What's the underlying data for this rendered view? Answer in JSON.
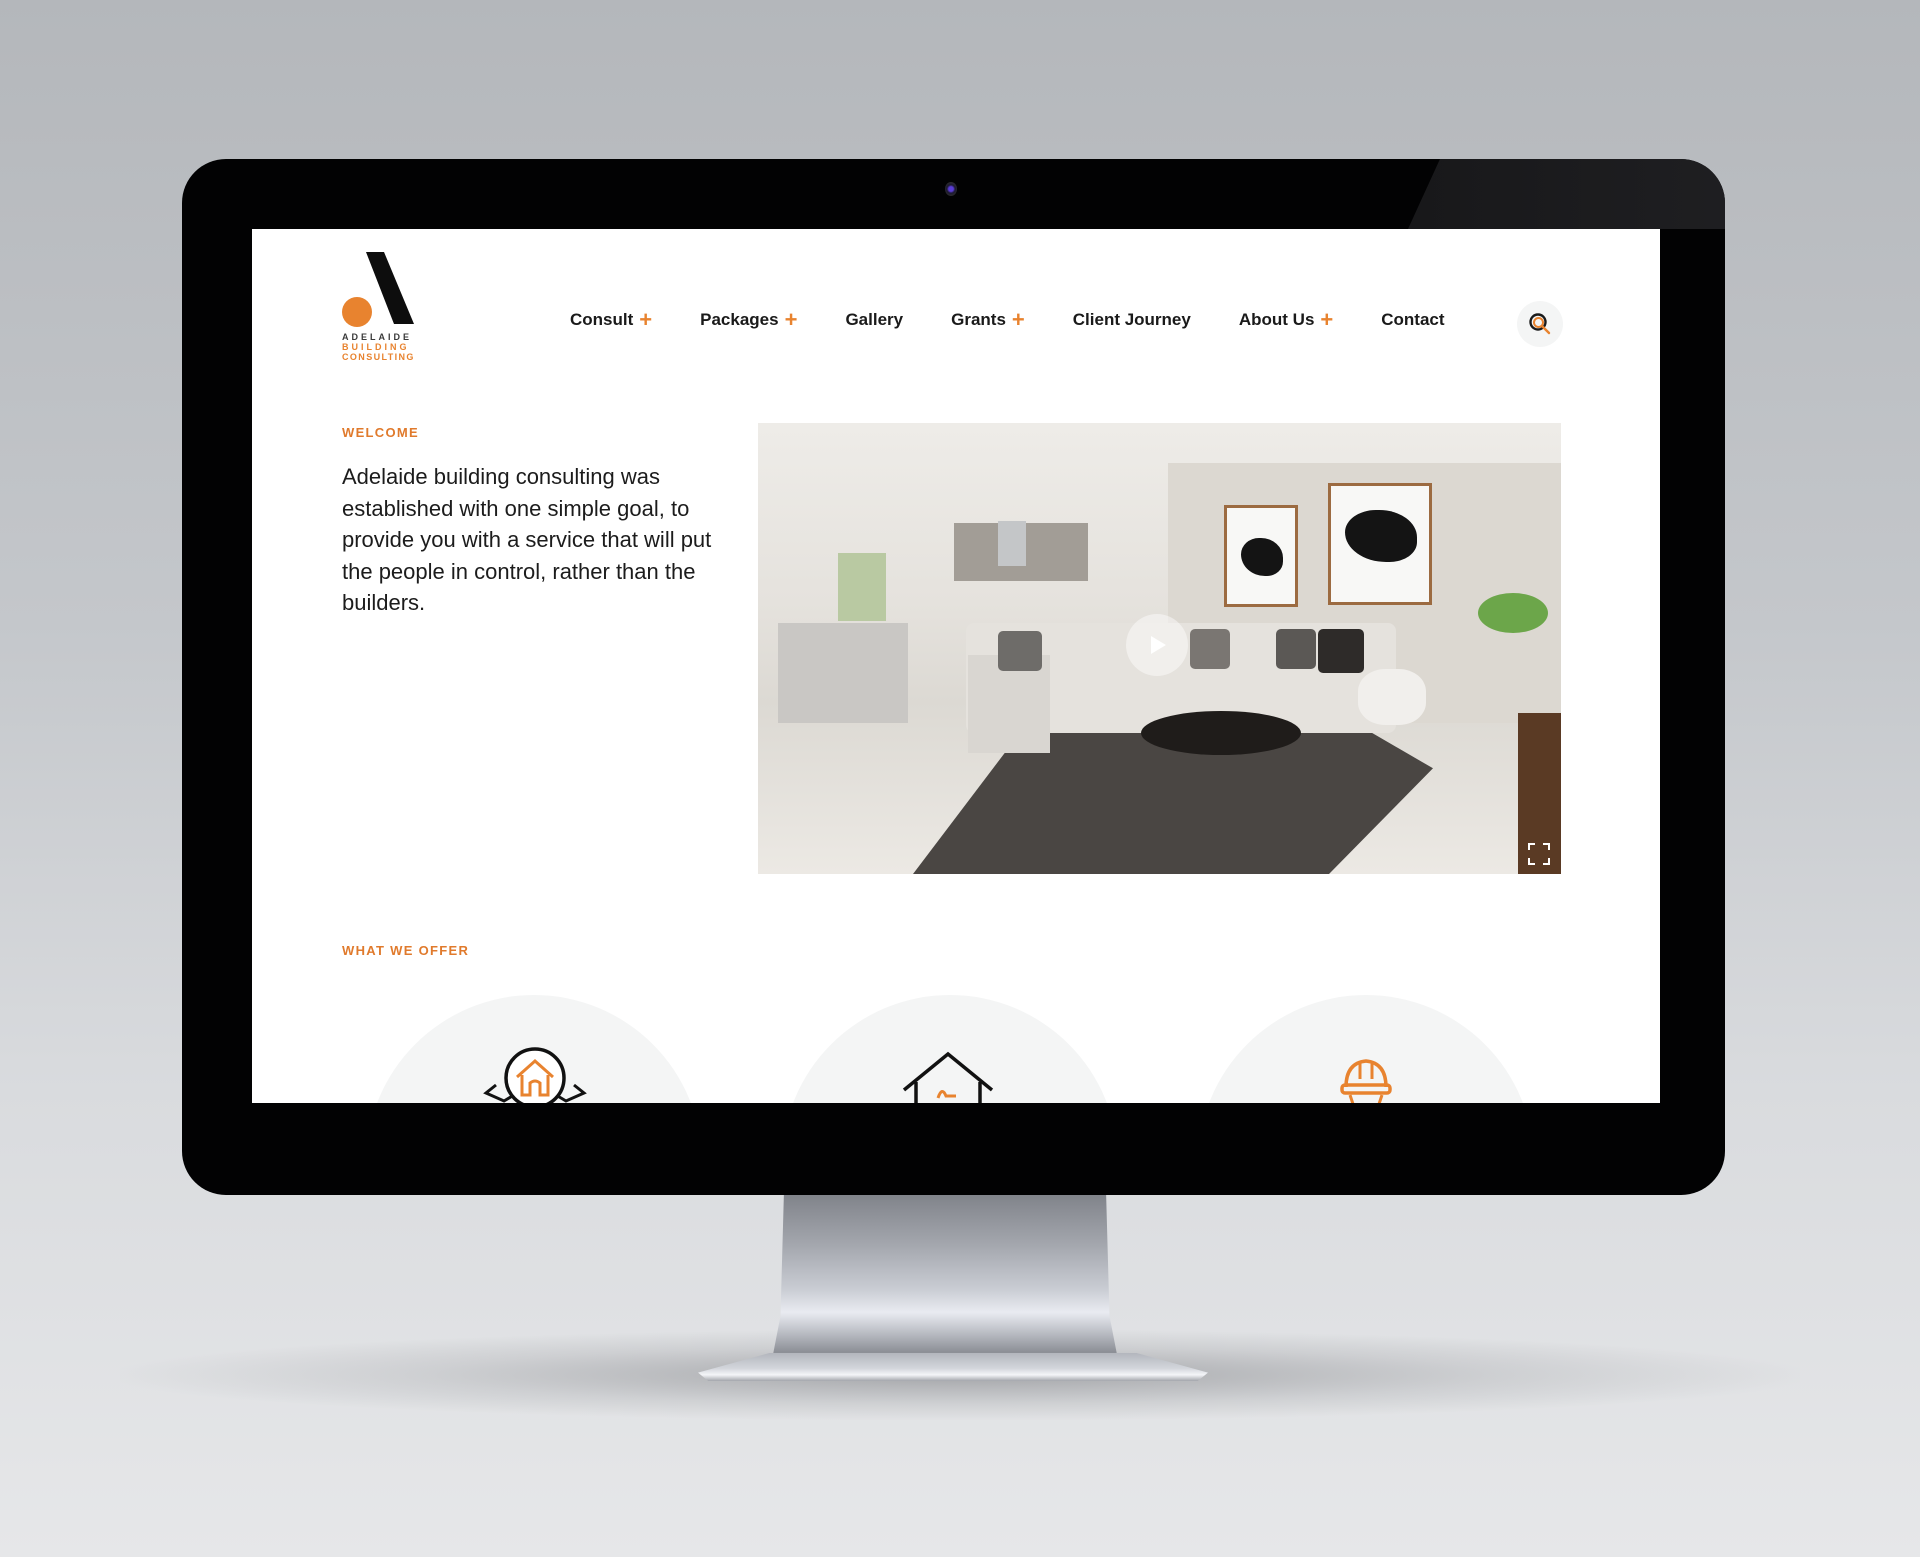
{
  "brand": {
    "logo_lines": [
      "ADELAIDE",
      "BUILDING",
      "CONSULTING"
    ],
    "accent_color": "#e8832f",
    "text_color": "#1a1a1a"
  },
  "nav": {
    "items": [
      {
        "label": "Consult",
        "has_submenu": true
      },
      {
        "label": "Packages",
        "has_submenu": true
      },
      {
        "label": "Gallery",
        "has_submenu": false
      },
      {
        "label": "Grants",
        "has_submenu": true
      },
      {
        "label": "Client Journey",
        "has_submenu": false
      },
      {
        "label": "About Us",
        "has_submenu": true
      },
      {
        "label": "Contact",
        "has_submenu": false
      }
    ],
    "submenu_icon": "+",
    "search_icon": "search-icon"
  },
  "welcome": {
    "eyebrow": "WELCOME",
    "body": "Adelaide building consulting was established with one simple goal, to provide you with a service that will put the people in control, rather than the builders."
  },
  "video": {
    "play_icon": "play-icon",
    "fullscreen_icon": "fullscreen-icon",
    "scene": "living-room-interior"
  },
  "offer": {
    "eyebrow": "WHAT WE OFFER",
    "cards": [
      {
        "icon": "house-badge-icon"
      },
      {
        "icon": "house-chair-icon"
      },
      {
        "icon": "hard-hat-icon"
      }
    ]
  }
}
